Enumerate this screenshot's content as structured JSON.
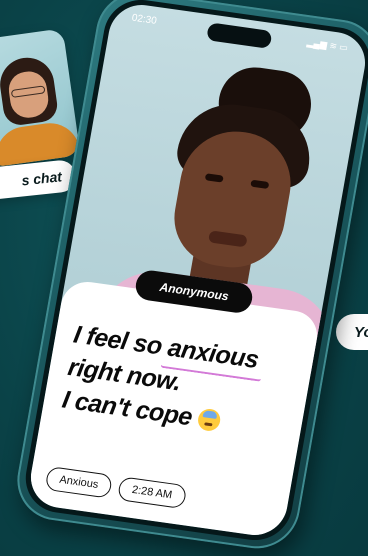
{
  "side_card": {
    "pill_label": "s chat"
  },
  "right_pill": {
    "label": "Yo"
  },
  "phone": {
    "status_time": "02:30",
    "status_icons": "▂▄▆ ≋ ▭"
  },
  "message_card": {
    "sender": "Anonymous",
    "line1_before": "I feel so ",
    "line1_highlight": "anxious",
    "line2": "right now.",
    "line3": "I can't cope",
    "tags": [
      {
        "label": "Anxious"
      },
      {
        "label": "2:28 AM"
      }
    ]
  },
  "colors": {
    "background": "#0d4a4f",
    "phone_frame": "#1b5c62",
    "highlight_underline": "#d37ad7",
    "anon_pill": "#0b0b0b"
  },
  "icons": {
    "emoji": "anxious-sweat-face-icon"
  }
}
